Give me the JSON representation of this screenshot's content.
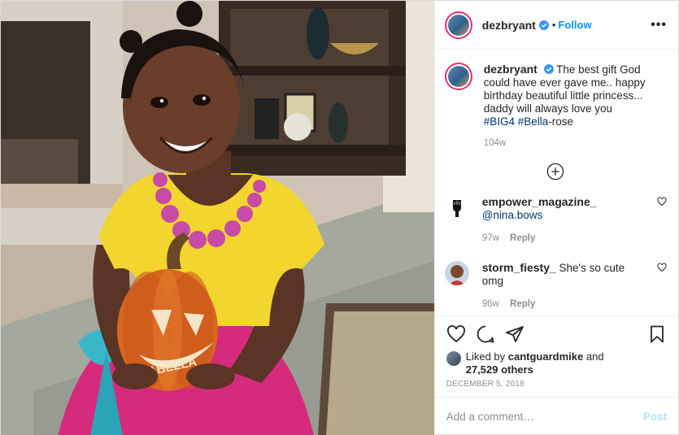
{
  "post": {
    "author": "dezbryant",
    "follow_label": "Follow",
    "more_label": "•••",
    "dot": "•",
    "caption": "The best gift God could have ever gave me.. happy birthday beautiful little princess... daddy will always love you",
    "hashtag1": "#BIG4",
    "hashtag2": "#Bella",
    "caption_tail": "-rose",
    "caption_time": "104w",
    "pumpkin_name": "ISABELLA",
    "accent_color": "#0095f6",
    "ring_color": "#e1306c",
    "verified_icon": "verified-badge-icon"
  },
  "comments": [
    {
      "user": "empower_magazine_",
      "text": "@nina.bows",
      "time": "97w",
      "reply": "Reply",
      "avatar_icon": "raised-fist-icon"
    },
    {
      "user": "storm_fiesty_",
      "text": "She's so cute omg",
      "time": "96w",
      "reply": "Reply",
      "avatar_icon": "user-photo-icon"
    }
  ],
  "likes": {
    "prefix": "Liked by",
    "user": "cantguardmike",
    "and": "and",
    "count": "27,529 others"
  },
  "date": "DECEMBER 5, 2018",
  "composer": {
    "placeholder": "Add a comment…",
    "post_label": "Post"
  }
}
